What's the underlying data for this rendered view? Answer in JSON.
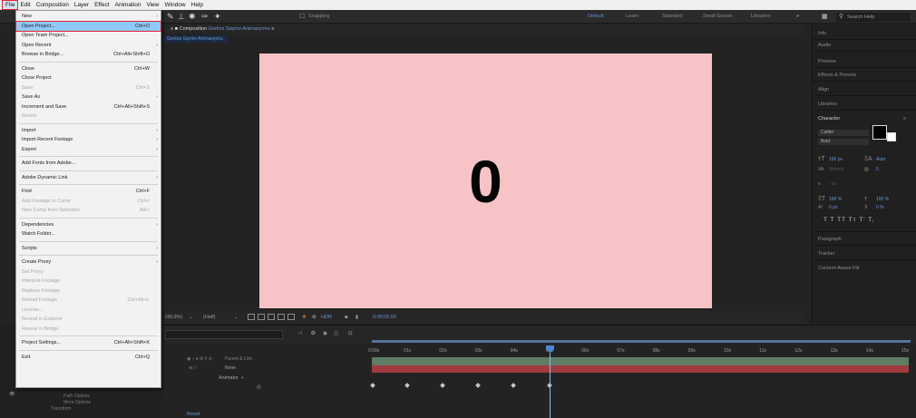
{
  "menubar": {
    "items": [
      "File",
      "Edit",
      "Composition",
      "Layer",
      "Effect",
      "Animation",
      "View",
      "Window",
      "Help"
    ]
  },
  "toolbar": {
    "snapping": "Snapping",
    "workspaces": [
      "Default",
      "Learn",
      "Standard",
      "Small Screen",
      "Libraries"
    ],
    "search_placeholder": "Search Help"
  },
  "composition": {
    "tab_prefix": "Composition",
    "name": "Gerkos Saymo Animasyonu",
    "breadcrumb": "Gerkos Saymo Animasyonu",
    "canvas_text": "0"
  },
  "viewer_footer": {
    "zoom": "(49,9%)",
    "resolution": "(Half)",
    "timecode": "0;00;05;00"
  },
  "right_panel": {
    "sections": [
      "Info",
      "Audio",
      "Preview",
      "Effects & Presets",
      "Align",
      "Libraries",
      "Character",
      "Paragraph",
      "Tracker",
      "Content-Aware Fill"
    ],
    "font": "Calibri",
    "style": "Bold",
    "font_size": "100 px",
    "leading": "Auto",
    "kerning": "Metrics",
    "tracking": "0",
    "stroke": "- px",
    "v_scale": "100 %",
    "h_scale": "100 %",
    "baseline": "0 px",
    "tsume": "0 %",
    "format_buttons": "T  T  TT  Tт  T'  T,"
  },
  "timeline": {
    "tick_labels": [
      "0:00s",
      "01s",
      "02s",
      "03s",
      "04s",
      "05s",
      "06s",
      "07s",
      "08s",
      "09s",
      "10s",
      "11s",
      "12s",
      "13s",
      "14s",
      "15s"
    ],
    "parent_link": "Parent & Link",
    "parent_value": "None",
    "animator": "Animator",
    "reset": "Reset"
  },
  "left_bottom": {
    "items": [
      "Path Options",
      "More Options",
      "Transform"
    ]
  },
  "file_menu": {
    "items": [
      {
        "label": "New",
        "shortcut": "",
        "submenu": true,
        "disabled": false
      },
      {
        "label": "Open Project...",
        "shortcut": "Ctrl+O",
        "submenu": false,
        "disabled": false,
        "highlight": true
      },
      {
        "label": "Open Team Project...",
        "shortcut": "",
        "submenu": false,
        "disabled": false
      },
      {
        "label": "Open Recent",
        "shortcut": "",
        "submenu": true,
        "disabled": false
      },
      {
        "label": "Browse in Bridge...",
        "shortcut": "Ctrl+Alt+Shift+O",
        "submenu": false,
        "disabled": false
      },
      {
        "label": "Close",
        "shortcut": "Ctrl+W",
        "submenu": false,
        "disabled": false,
        "sep_before": true
      },
      {
        "label": "Close Project",
        "shortcut": "",
        "submenu": false,
        "disabled": false
      },
      {
        "label": "Save",
        "shortcut": "Ctrl+S",
        "submenu": false,
        "disabled": true
      },
      {
        "label": "Save As",
        "shortcut": "",
        "submenu": true,
        "disabled": false
      },
      {
        "label": "Increment and Save",
        "shortcut": "Ctrl+Alt+Shift+S",
        "submenu": false,
        "disabled": false
      },
      {
        "label": "Revert",
        "shortcut": "",
        "submenu": false,
        "disabled": true
      },
      {
        "label": "Import",
        "shortcut": "",
        "submenu": true,
        "disabled": false,
        "sep_before": true
      },
      {
        "label": "Import Recent Footage",
        "shortcut": "",
        "submenu": true,
        "disabled": false
      },
      {
        "label": "Export",
        "shortcut": "",
        "submenu": true,
        "disabled": false
      },
      {
        "label": "Add Fonts from Adobe...",
        "shortcut": "",
        "submenu": false,
        "disabled": false,
        "sep_before": true
      },
      {
        "label": "Adobe Dynamic Link",
        "shortcut": "",
        "submenu": true,
        "disabled": false,
        "sep_before": true
      },
      {
        "label": "Find",
        "shortcut": "Ctrl+F",
        "submenu": false,
        "disabled": false,
        "sep_before": true
      },
      {
        "label": "Add Footage to Comp",
        "shortcut": "Ctrl+/",
        "submenu": false,
        "disabled": true
      },
      {
        "label": "New Comp from Selection",
        "shortcut": "Alt+\\",
        "submenu": false,
        "disabled": true
      },
      {
        "label": "Dependencies",
        "shortcut": "",
        "submenu": true,
        "disabled": false,
        "sep_before": true
      },
      {
        "label": "Watch Folder...",
        "shortcut": "",
        "submenu": false,
        "disabled": false
      },
      {
        "label": "Scripts",
        "shortcut": "",
        "submenu": true,
        "disabled": false,
        "sep_before": true
      },
      {
        "label": "Create Proxy",
        "shortcut": "",
        "submenu": true,
        "disabled": false,
        "sep_before": true
      },
      {
        "label": "Set Proxy",
        "shortcut": "",
        "submenu": false,
        "disabled": true
      },
      {
        "label": "Interpret Footage",
        "shortcut": "",
        "submenu": false,
        "disabled": true
      },
      {
        "label": "Replace Footage",
        "shortcut": "",
        "submenu": false,
        "disabled": true
      },
      {
        "label": "Reload Footage",
        "shortcut": "Ctrl+Alt+L",
        "submenu": false,
        "disabled": true
      },
      {
        "label": "License...",
        "shortcut": "",
        "submenu": false,
        "disabled": true
      },
      {
        "label": "Reveal in Explorer",
        "shortcut": "",
        "submenu": false,
        "disabled": true
      },
      {
        "label": "Reveal in Bridge",
        "shortcut": "",
        "submenu": false,
        "disabled": true
      },
      {
        "label": "Project Settings...",
        "shortcut": "Ctrl+Alt+Shift+K",
        "submenu": false,
        "disabled": false,
        "sep_before": true
      },
      {
        "label": "Exit",
        "shortcut": "Ctrl+Q",
        "submenu": false,
        "disabled": false,
        "sep_before": true
      }
    ]
  }
}
